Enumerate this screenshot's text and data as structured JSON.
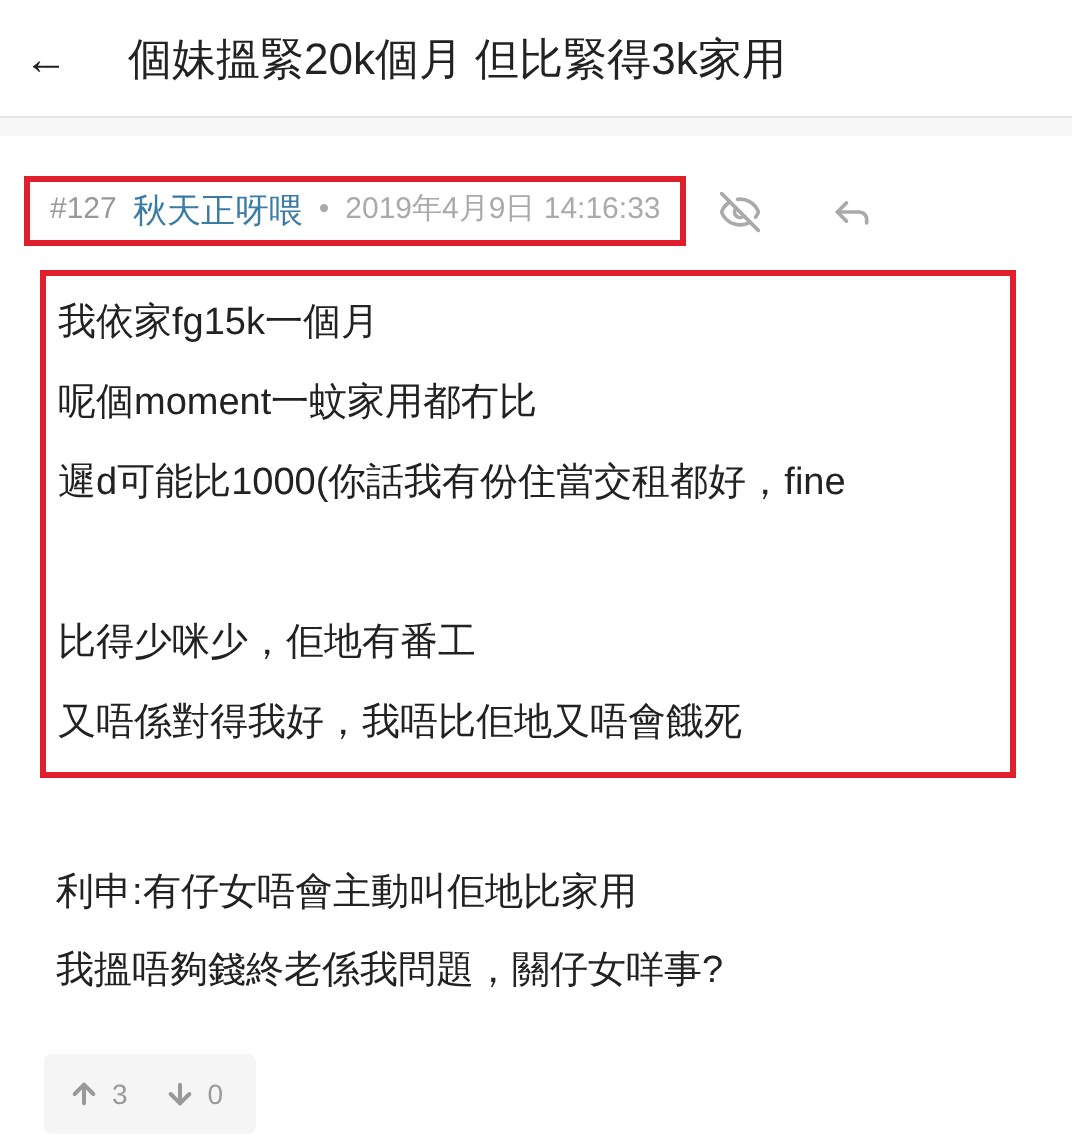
{
  "header": {
    "back_icon": "←",
    "title": "個妹搵緊20k個月 但比緊得3k家用"
  },
  "post": {
    "number": "#127",
    "author": "秋天正呀喂",
    "separator": "•",
    "time": "2019年4月9日 14:16:33",
    "meta_highlighted": true,
    "quote_highlighted": true,
    "quote_paragraphs": [
      [
        "我依家fg15k一個月",
        "呢個moment一蚊家用都冇比",
        "遲d可能比1000(你話我有份住當交租都好，fine"
      ],
      [
        "比得少咪少，佢地有番工",
        "又唔係對得我好，我唔比佢地又唔會餓死"
      ]
    ],
    "reply_lines": [
      "利申:有仔女唔會主動叫佢地比家用",
      "我搵唔夠錢終老係我問題，關仔女咩事?"
    ],
    "upvotes": "3",
    "downvotes": "0"
  }
}
